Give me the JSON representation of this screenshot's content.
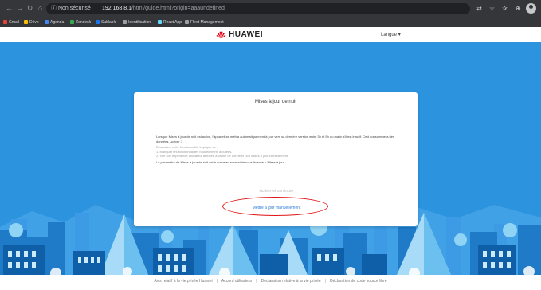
{
  "browser": {
    "security_label": "Non sécurisé",
    "url_host": "192.168.8.1",
    "url_rest": "/html/guide.html?origin=aaaundefined",
    "bookmarks": [
      "Gmail",
      "Drive",
      "Agenda",
      "Zendesk",
      "Sublable",
      "Identification",
      "React App",
      "Fleet Management"
    ],
    "bookmark_colors": [
      "#ea4335",
      "#fbbc04",
      "#4285f4",
      "#34a853",
      "#1a73e8",
      "#9e9e9e",
      "#61dafb",
      "#9e9e9e"
    ]
  },
  "header": {
    "brand": "HUAWEI",
    "brand_color": "#e60012",
    "language_label": "Langue ▾"
  },
  "dialog": {
    "title": "Mises à jour de nuit",
    "paragraph1": "Lorsque Mises à jour de nuit est activé, l'appareil se mettra automatiquement à jour vers sa dernière version entre 3h et 5h du matin s'il est inactif. Ceci consommera des données. Activer ?",
    "disable_heading": "Désactiver cette fonctionnalité implique de :",
    "disable_item1": "1. Manquer les fonctionnalités nouvellement ajoutées.",
    "disable_item2": "2. Voir son expérience utilisateur affectée à cause de données non mises à jour correctement.",
    "paragraph2": "Le paramètre de Mises à jour de nuit est à nouveau accessible sous Avancé > Mises à jour.",
    "activate_label": "Activer et continuer",
    "manual_label": "Mettre à jour manuellement"
  },
  "footer": {
    "links": [
      "Avis relatif à la vie privée Huawei",
      "Accord utilisateur",
      "Déclaration relative à la vie privée",
      "Déclaration de code source libre"
    ]
  },
  "colors": {
    "background_blue": "#2c93df",
    "highlight_circle": "#e01414",
    "link_blue": "#2c7ad6"
  }
}
